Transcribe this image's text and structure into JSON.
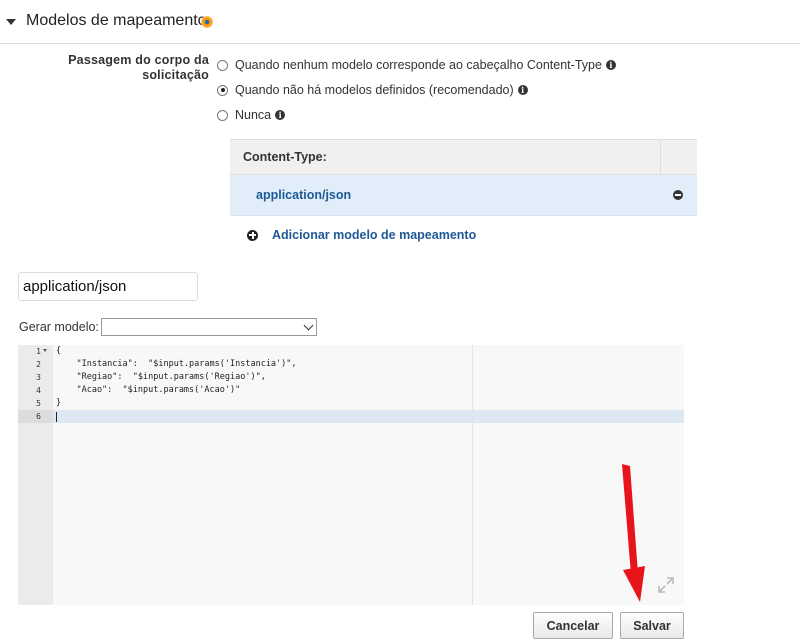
{
  "section": {
    "title": "Modelos de mapeamento"
  },
  "passthrough": {
    "label": "Passagem do corpo da solicitação",
    "options": [
      {
        "label": "Quando nenhum modelo corresponde ao cabeçalho Content-Type",
        "selected": false
      },
      {
        "label": "Quando não há modelos definidos (recomendado)",
        "selected": true
      },
      {
        "label": "Nunca",
        "selected": false
      }
    ]
  },
  "content_types": {
    "header": "Content-Type:",
    "rows": [
      "application/json"
    ],
    "add_label": "Adicionar modelo de mapeamento"
  },
  "content_type_input": {
    "value": "application/json"
  },
  "generate": {
    "label": "Gerar modelo:",
    "selected": ""
  },
  "editor": {
    "lines": [
      {
        "num": "1",
        "text": "{"
      },
      {
        "num": "2",
        "text": "    \"Instancia\":  \"$input.params('Instancia')\","
      },
      {
        "num": "3",
        "text": "    \"Regiao\":  \"$input.params('Regiao')\","
      },
      {
        "num": "4",
        "text": "    \"Acao\":  \"$input.params('Acao')\""
      },
      {
        "num": "5",
        "text": "}"
      },
      {
        "num": "6",
        "text": ""
      }
    ],
    "active_line": 6
  },
  "buttons": {
    "cancel": "Cancelar",
    "save": "Salvar"
  },
  "colors": {
    "link": "#1e5a96",
    "selected_row": "#e1edf8",
    "annotation_arrow": "#e8141b",
    "status_dot": "#ff9900"
  },
  "icons": [
    "chevron-down-icon",
    "status-dot-icon",
    "info-icon",
    "minus-circle-icon",
    "plus-circle-icon",
    "resize-icon"
  ]
}
